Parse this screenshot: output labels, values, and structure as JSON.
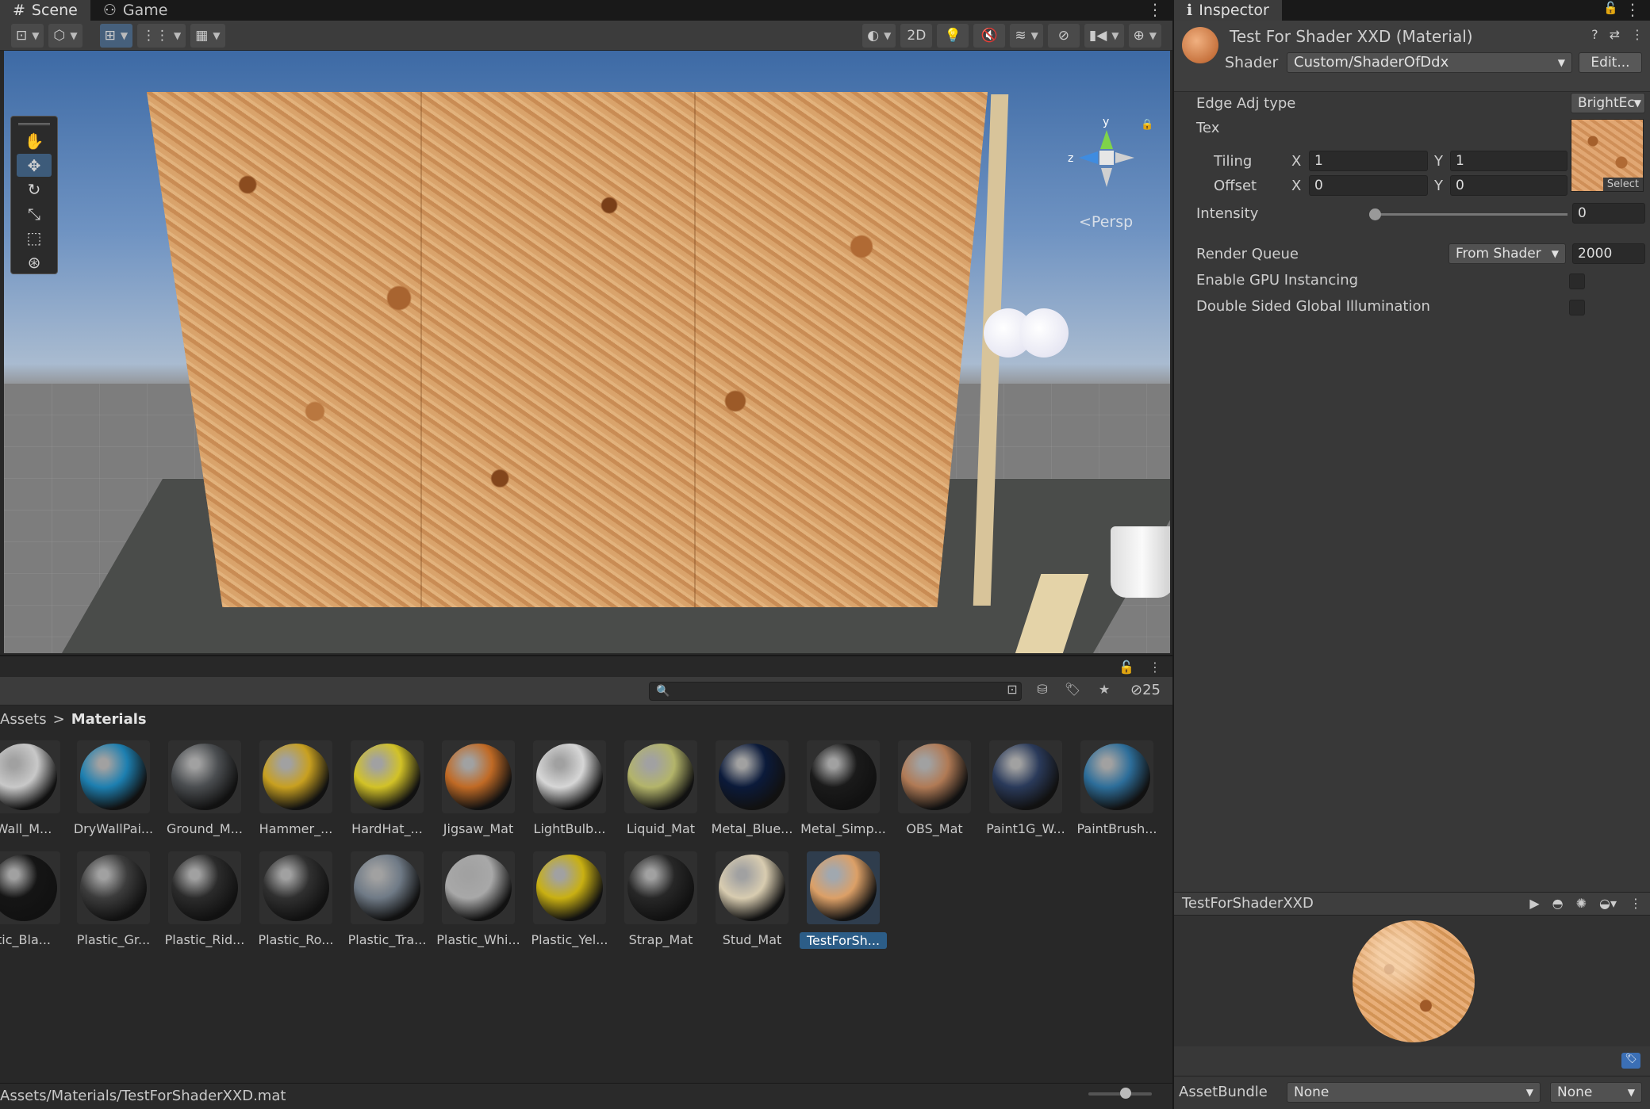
{
  "scene_tabs": [
    {
      "label": "Scene",
      "icon": "hash-icon"
    },
    {
      "label": "Game",
      "icon": "gamepad-icon"
    }
  ],
  "scene_toolbar": {
    "toggle_2d": "2D"
  },
  "scene_view": {
    "persp_label": "Persp",
    "axis_y": "y",
    "axis_z": "z"
  },
  "project": {
    "search_placeholder": "",
    "hidden_count": "25",
    "breadcrumb_root": "Assets",
    "breadcrumb_separator": ">",
    "breadcrumb_current": "Materials",
    "items": [
      {
        "label": "Wall_M...",
        "color": "#c8c8c8"
      },
      {
        "label": "DryWallPai...",
        "color": "#1d7fb0"
      },
      {
        "label": "Ground_M...",
        "color": "#4a4d50"
      },
      {
        "label": "Hammer_...",
        "color": "#c8a020"
      },
      {
        "label": "HardHat_...",
        "color": "#d2c227"
      },
      {
        "label": "Jigsaw_Mat",
        "color": "#c06a25"
      },
      {
        "label": "LightBulb...",
        "color": "#d6d6d6"
      },
      {
        "label": "Liquid_Mat",
        "color": "#b3b46a"
      },
      {
        "label": "Metal_Blue...",
        "color": "#0b1a3a"
      },
      {
        "label": "Metal_Simp...",
        "color": "#1a1a1a"
      },
      {
        "label": "OBS_Mat",
        "color": "#b07a55"
      },
      {
        "label": "Paint1G_W...",
        "color": "#2a3a5a"
      },
      {
        "label": "PaintBrush...",
        "color": "#2d6e9a"
      },
      {
        "label": "tic_Bla...",
        "color": "#151515"
      },
      {
        "label": "Plastic_Gr...",
        "color": "#3c3c3c"
      },
      {
        "label": "Plastic_Rid...",
        "color": "#2b2b2b"
      },
      {
        "label": "Plastic_Ro...",
        "color": "#303030"
      },
      {
        "label": "Plastic_Tra...",
        "color": "#6f7a86"
      },
      {
        "label": "Plastic_Whi...",
        "color": "#a8a8a8"
      },
      {
        "label": "Plastic_Yel...",
        "color": "#c9b012"
      },
      {
        "label": "Strap_Mat",
        "color": "#272727"
      },
      {
        "label": "Stud_Mat",
        "color": "#d8ccb0"
      },
      {
        "label": "TestForSh...",
        "color": "#dca067",
        "selected": true
      }
    ],
    "status_path": "Assets/Materials/TestForShaderXXD.mat"
  },
  "inspector": {
    "tab_label": "Inspector",
    "material_title": "Test For Shader XXD (Material)",
    "shader_label": "Shader",
    "shader_value": "Custom/ShaderOfDdx",
    "edit_button": "Edit...",
    "edge_adj_label": "Edge Adj type",
    "edge_adj_value": "BrightEc",
    "tex_label": "Tex",
    "tiling_label": "Tiling",
    "offset_label": "Offset",
    "x_label": "X",
    "y_label": "Y",
    "tiling_x": "1",
    "tiling_y": "1",
    "offset_x": "0",
    "offset_y": "0",
    "select_label": "Select",
    "intensity_label": "Intensity",
    "intensity_value": "0",
    "intensity_level": 0,
    "render_queue_label": "Render Queue",
    "render_queue_mode": "From Shader",
    "render_queue_value": "2000",
    "gpu_instancing_label": "Enable GPU Instancing",
    "gpu_instancing_checked": false,
    "double_sided_label": "Double Sided Global Illumination",
    "double_sided_checked": false,
    "preview_title": "TestForShaderXXD",
    "assetbundle_label": "AssetBundle",
    "assetbundle_value": "None",
    "assetbundle_variant": "None"
  }
}
